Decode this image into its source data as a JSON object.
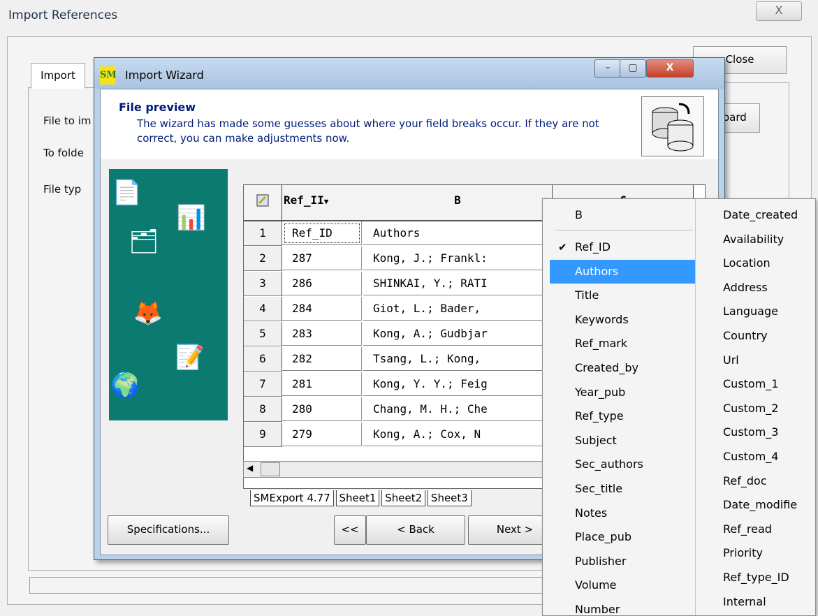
{
  "outer": {
    "title": "Import References",
    "close_glyph": "X",
    "tab_import": "Import",
    "label_file_to": "File to im",
    "label_folder": "To folde",
    "label_filetype": "File typ",
    "close_button": "Close",
    "board_button": "oard"
  },
  "wizard": {
    "title": "Import Wizard",
    "icon_text": "SM",
    "min_glyph": "–",
    "max_glyph": "▢",
    "close_glyph": "X",
    "section_title": "File preview",
    "description": "The wizard has made some guesses about where your field breaks occur. If they are not correct, you can make adjustments now.",
    "grid": {
      "columns": [
        "Ref_II",
        "B",
        "C"
      ],
      "rows": [
        {
          "n": "1",
          "a": "Ref_ID",
          "b": "Authors"
        },
        {
          "n": "2",
          "a": "287",
          "b": "Kong, J.; Frankl:"
        },
        {
          "n": "3",
          "a": "286",
          "b": "SHINKAI, Y.; RATI"
        },
        {
          "n": "4",
          "a": "284",
          "b": "Giot, L.; Bader,"
        },
        {
          "n": "5",
          "a": "283",
          "b": "Kong, A.; Gudbjar"
        },
        {
          "n": "6",
          "a": "282",
          "b": "Tsang, L.; Kong,"
        },
        {
          "n": "7",
          "a": "281",
          "b": "Kong, Y. Y.; Feig"
        },
        {
          "n": "8",
          "a": "280",
          "b": "Chang, M. H.; Che"
        },
        {
          "n": "9",
          "a": "279",
          "b": "Kong, A.; Cox, N"
        }
      ]
    },
    "sheets": [
      "SMExport 4.77",
      "Sheet1",
      "Sheet2",
      "Sheet3"
    ],
    "buttons": {
      "specs": "Specifications...",
      "first": "<<",
      "back": "< Back",
      "next": "Next >"
    }
  },
  "menu": {
    "header": "B",
    "col1": [
      {
        "label": "Ref_ID",
        "checked": true
      },
      {
        "label": "Authors",
        "selected": true
      },
      {
        "label": "Title"
      },
      {
        "label": "Keywords"
      },
      {
        "label": "Ref_mark"
      },
      {
        "label": "Created_by"
      },
      {
        "label": "Year_pub"
      },
      {
        "label": "Ref_type"
      },
      {
        "label": "Subject"
      },
      {
        "label": "Sec_authors"
      },
      {
        "label": "Sec_title"
      },
      {
        "label": "Notes"
      },
      {
        "label": "Place_pub"
      },
      {
        "label": "Publisher"
      },
      {
        "label": "Volume"
      },
      {
        "label": "Number"
      }
    ],
    "col2": [
      "Date_created",
      "Availability",
      "Location",
      "Address",
      "Language",
      "Country",
      "Url",
      "Custom_1",
      "Custom_2",
      "Custom_3",
      "Custom_4",
      "Ref_doc",
      "Date_modifie",
      "Ref_read",
      "Priority",
      "Ref_type_ID",
      "Internal"
    ]
  },
  "colors": {
    "selection": "#3399ff",
    "teal_panel": "#0b7b72",
    "wizard_text": "#001b7a"
  }
}
